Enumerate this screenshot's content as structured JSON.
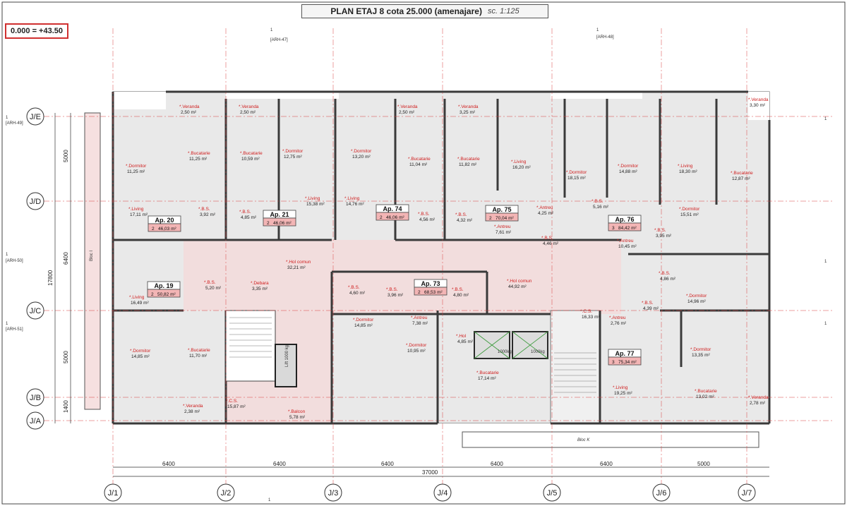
{
  "title": "PLAN ETAJ 8 cota 25.000 (amenajare)",
  "scale": "sc. 1:125",
  "reference_level": "0.000 = +43.50",
  "grid_rows": [
    "J/E",
    "J/D",
    "J/C",
    "J/B",
    "J/A"
  ],
  "grid_cols": [
    "J/1",
    "J/2",
    "J/3",
    "J/4",
    "J/5",
    "J/6",
    "J/7"
  ],
  "ref_labels": [
    "[ARH-47]",
    "[ARH-48]",
    "[ARH-49]",
    "[ARH-50]",
    "[ARH-51]"
  ],
  "section_mark": "1",
  "left_dims": [
    "5000",
    "6400",
    "5000",
    "1400"
  ],
  "left_total": "17800",
  "bottom_dims": [
    "6400",
    "6400",
    "6400",
    "6400",
    "6400",
    "5000"
  ],
  "bottom_total": "37000",
  "bloc_left": "Bloc I",
  "bloc_bottom": "Bloc K",
  "apartments": [
    {
      "name": "Ap. 20",
      "rooms": "2",
      "area": "46,03 m²"
    },
    {
      "name": "Ap. 21",
      "rooms": "2",
      "area": "46,06 m²"
    },
    {
      "name": "Ap. 74",
      "rooms": "2",
      "area": "46,06 m²"
    },
    {
      "name": "Ap. 75",
      "rooms": "2",
      "area": "70,04 m²"
    },
    {
      "name": "Ap. 76",
      "rooms": "3",
      "area": "84,42 m²"
    },
    {
      "name": "Ap. 19",
      "rooms": "2",
      "area": "50,82 m²"
    },
    {
      "name": "Ap. 73",
      "rooms": "2",
      "area": "68,53 m²"
    },
    {
      "name": "Ap. 77",
      "rooms": "3",
      "area": "75,34 m²"
    }
  ],
  "rooms": [
    {
      "name": "*.Veranda",
      "area": "2,50 m²"
    },
    {
      "name": "*.Veranda",
      "area": "2,50 m²"
    },
    {
      "name": "*.Veranda",
      "area": "2,50 m²"
    },
    {
      "name": "*.Veranda",
      "area": "3,25 m²"
    },
    {
      "name": "*.Veranda",
      "area": "3,30 m²"
    },
    {
      "name": "*.Bucatarie",
      "area": "11,25 m²"
    },
    {
      "name": "*.Bucatarie",
      "area": "10,59 m²"
    },
    {
      "name": "*.Dormitor",
      "area": "12,75 m²"
    },
    {
      "name": "*.Dormitor",
      "area": "13,20 m²"
    },
    {
      "name": "*.Bucatarie",
      "area": "11,04 m²"
    },
    {
      "name": "*.Bucatarie",
      "area": "11,82 m²"
    },
    {
      "name": "*.Living",
      "area": "16,20 m²"
    },
    {
      "name": "*.Dormitor",
      "area": "18,15 m²"
    },
    {
      "name": "*.Dormitor",
      "area": "14,88 m²"
    },
    {
      "name": "*.Living",
      "area": "18,30 m²"
    },
    {
      "name": "*.Bucatarie",
      "area": "12,87 m²"
    },
    {
      "name": "*.Dormitor",
      "area": "11,25 m²"
    },
    {
      "name": "*.Living",
      "area": "15,38 m²"
    },
    {
      "name": "*.Living",
      "area": "14,76 m²"
    },
    {
      "name": "*.Living",
      "area": "17,11 m²"
    },
    {
      "name": "*.B.S.",
      "area": "3,92 m²"
    },
    {
      "name": "*.B.S.",
      "area": "4,85 m²"
    },
    {
      "name": "*.B.S.",
      "area": "4,56 m²"
    },
    {
      "name": "*.B.S.",
      "area": "4,32 m²"
    },
    {
      "name": "*.Antreu",
      "area": "4,25 m²"
    },
    {
      "name": "*.B.S.",
      "area": "5,16 m²"
    },
    {
      "name": "*.Dormitor",
      "area": "15,51 m²"
    },
    {
      "name": "*.Antreu",
      "area": "7,61 m²"
    },
    {
      "name": "*.B.S.",
      "area": "4,46 m²"
    },
    {
      "name": "*.Antreu",
      "area": "10,45 m²"
    },
    {
      "name": "*.B.S.",
      "area": "3,95 m²"
    },
    {
      "name": "*.Hol comun",
      "area": "32,21 m²"
    },
    {
      "name": "*.Living",
      "area": "16,49 m²"
    },
    {
      "name": "*.B.S.",
      "area": "5,20 m²"
    },
    {
      "name": "*.Debara",
      "area": "3,35 m²"
    },
    {
      "name": "*.B.S.",
      "area": "4,60 m²"
    },
    {
      "name": "*.B.S.",
      "area": "3,96 m²"
    },
    {
      "name": "*.B.S.",
      "area": "4,80 m²"
    },
    {
      "name": "*.Hol comun",
      "area": "44,92 m²"
    },
    {
      "name": "*.B.S.",
      "area": "4,86 m²"
    },
    {
      "name": "*.Dormitor",
      "area": "14,96 m²"
    },
    {
      "name": "*.B.S.",
      "area": "4,39 m²"
    },
    {
      "name": "*.Antreu",
      "area": "2,76 m²"
    },
    {
      "name": "*.C.S.",
      "area": "16,33 m²"
    },
    {
      "name": "*.Dormitor",
      "area": "14,85 m²"
    },
    {
      "name": "*.Antreu",
      "area": "7,38 m²"
    },
    {
      "name": "*.Dormitor",
      "area": "10,95 m²"
    },
    {
      "name": "*.Hol",
      "area": "4,85 m²"
    },
    {
      "name": "*.Dormitor",
      "area": "14,85 m²"
    },
    {
      "name": "*.Bucatarie",
      "area": "11,70 m²"
    },
    {
      "name": "*.Bucatarie",
      "area": "17,14 m²"
    },
    {
      "name": "*.Dormitor",
      "area": "13,35 m²"
    },
    {
      "name": "*.Veranda",
      "area": "2,38 m²"
    },
    {
      "name": "*.C.S.",
      "area": "15,87 m²"
    },
    {
      "name": "*.Balcon",
      "area": "5,78 m²"
    },
    {
      "name": "*.Living",
      "area": "19,25 m²"
    },
    {
      "name": "*.Bucatarie",
      "area": "13,02 m²"
    },
    {
      "name": "*.Veranda",
      "area": "2,78 m²"
    }
  ],
  "elevator_labels": [
    "1000kg",
    "1000kg"
  ],
  "stair_label": "Lift 1000 kg"
}
